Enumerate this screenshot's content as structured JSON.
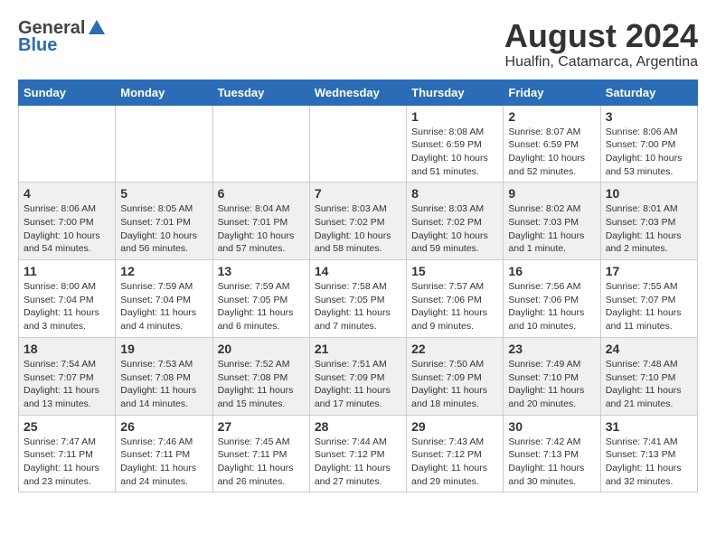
{
  "logo": {
    "general": "General",
    "blue": "Blue"
  },
  "title": {
    "month_year": "August 2024",
    "location": "Hualfin, Catamarca, Argentina"
  },
  "days_of_week": [
    "Sunday",
    "Monday",
    "Tuesday",
    "Wednesday",
    "Thursday",
    "Friday",
    "Saturday"
  ],
  "weeks": [
    [
      {
        "day": "",
        "info": ""
      },
      {
        "day": "",
        "info": ""
      },
      {
        "day": "",
        "info": ""
      },
      {
        "day": "",
        "info": ""
      },
      {
        "day": "1",
        "info": "Sunrise: 8:08 AM\nSunset: 6:59 PM\nDaylight: 10 hours\nand 51 minutes."
      },
      {
        "day": "2",
        "info": "Sunrise: 8:07 AM\nSunset: 6:59 PM\nDaylight: 10 hours\nand 52 minutes."
      },
      {
        "day": "3",
        "info": "Sunrise: 8:06 AM\nSunset: 7:00 PM\nDaylight: 10 hours\nand 53 minutes."
      }
    ],
    [
      {
        "day": "4",
        "info": "Sunrise: 8:06 AM\nSunset: 7:00 PM\nDaylight: 10 hours\nand 54 minutes."
      },
      {
        "day": "5",
        "info": "Sunrise: 8:05 AM\nSunset: 7:01 PM\nDaylight: 10 hours\nand 56 minutes."
      },
      {
        "day": "6",
        "info": "Sunrise: 8:04 AM\nSunset: 7:01 PM\nDaylight: 10 hours\nand 57 minutes."
      },
      {
        "day": "7",
        "info": "Sunrise: 8:03 AM\nSunset: 7:02 PM\nDaylight: 10 hours\nand 58 minutes."
      },
      {
        "day": "8",
        "info": "Sunrise: 8:03 AM\nSunset: 7:02 PM\nDaylight: 10 hours\nand 59 minutes."
      },
      {
        "day": "9",
        "info": "Sunrise: 8:02 AM\nSunset: 7:03 PM\nDaylight: 11 hours\nand 1 minute."
      },
      {
        "day": "10",
        "info": "Sunrise: 8:01 AM\nSunset: 7:03 PM\nDaylight: 11 hours\nand 2 minutes."
      }
    ],
    [
      {
        "day": "11",
        "info": "Sunrise: 8:00 AM\nSunset: 7:04 PM\nDaylight: 11 hours\nand 3 minutes."
      },
      {
        "day": "12",
        "info": "Sunrise: 7:59 AM\nSunset: 7:04 PM\nDaylight: 11 hours\nand 4 minutes."
      },
      {
        "day": "13",
        "info": "Sunrise: 7:59 AM\nSunset: 7:05 PM\nDaylight: 11 hours\nand 6 minutes."
      },
      {
        "day": "14",
        "info": "Sunrise: 7:58 AM\nSunset: 7:05 PM\nDaylight: 11 hours\nand 7 minutes."
      },
      {
        "day": "15",
        "info": "Sunrise: 7:57 AM\nSunset: 7:06 PM\nDaylight: 11 hours\nand 9 minutes."
      },
      {
        "day": "16",
        "info": "Sunrise: 7:56 AM\nSunset: 7:06 PM\nDaylight: 11 hours\nand 10 minutes."
      },
      {
        "day": "17",
        "info": "Sunrise: 7:55 AM\nSunset: 7:07 PM\nDaylight: 11 hours\nand 11 minutes."
      }
    ],
    [
      {
        "day": "18",
        "info": "Sunrise: 7:54 AM\nSunset: 7:07 PM\nDaylight: 11 hours\nand 13 minutes."
      },
      {
        "day": "19",
        "info": "Sunrise: 7:53 AM\nSunset: 7:08 PM\nDaylight: 11 hours\nand 14 minutes."
      },
      {
        "day": "20",
        "info": "Sunrise: 7:52 AM\nSunset: 7:08 PM\nDaylight: 11 hours\nand 15 minutes."
      },
      {
        "day": "21",
        "info": "Sunrise: 7:51 AM\nSunset: 7:09 PM\nDaylight: 11 hours\nand 17 minutes."
      },
      {
        "day": "22",
        "info": "Sunrise: 7:50 AM\nSunset: 7:09 PM\nDaylight: 11 hours\nand 18 minutes."
      },
      {
        "day": "23",
        "info": "Sunrise: 7:49 AM\nSunset: 7:10 PM\nDaylight: 11 hours\nand 20 minutes."
      },
      {
        "day": "24",
        "info": "Sunrise: 7:48 AM\nSunset: 7:10 PM\nDaylight: 11 hours\nand 21 minutes."
      }
    ],
    [
      {
        "day": "25",
        "info": "Sunrise: 7:47 AM\nSunset: 7:11 PM\nDaylight: 11 hours\nand 23 minutes."
      },
      {
        "day": "26",
        "info": "Sunrise: 7:46 AM\nSunset: 7:11 PM\nDaylight: 11 hours\nand 24 minutes."
      },
      {
        "day": "27",
        "info": "Sunrise: 7:45 AM\nSunset: 7:11 PM\nDaylight: 11 hours\nand 26 minutes."
      },
      {
        "day": "28",
        "info": "Sunrise: 7:44 AM\nSunset: 7:12 PM\nDaylight: 11 hours\nand 27 minutes."
      },
      {
        "day": "29",
        "info": "Sunrise: 7:43 AM\nSunset: 7:12 PM\nDaylight: 11 hours\nand 29 minutes."
      },
      {
        "day": "30",
        "info": "Sunrise: 7:42 AM\nSunset: 7:13 PM\nDaylight: 11 hours\nand 30 minutes."
      },
      {
        "day": "31",
        "info": "Sunrise: 7:41 AM\nSunset: 7:13 PM\nDaylight: 11 hours\nand 32 minutes."
      }
    ]
  ]
}
